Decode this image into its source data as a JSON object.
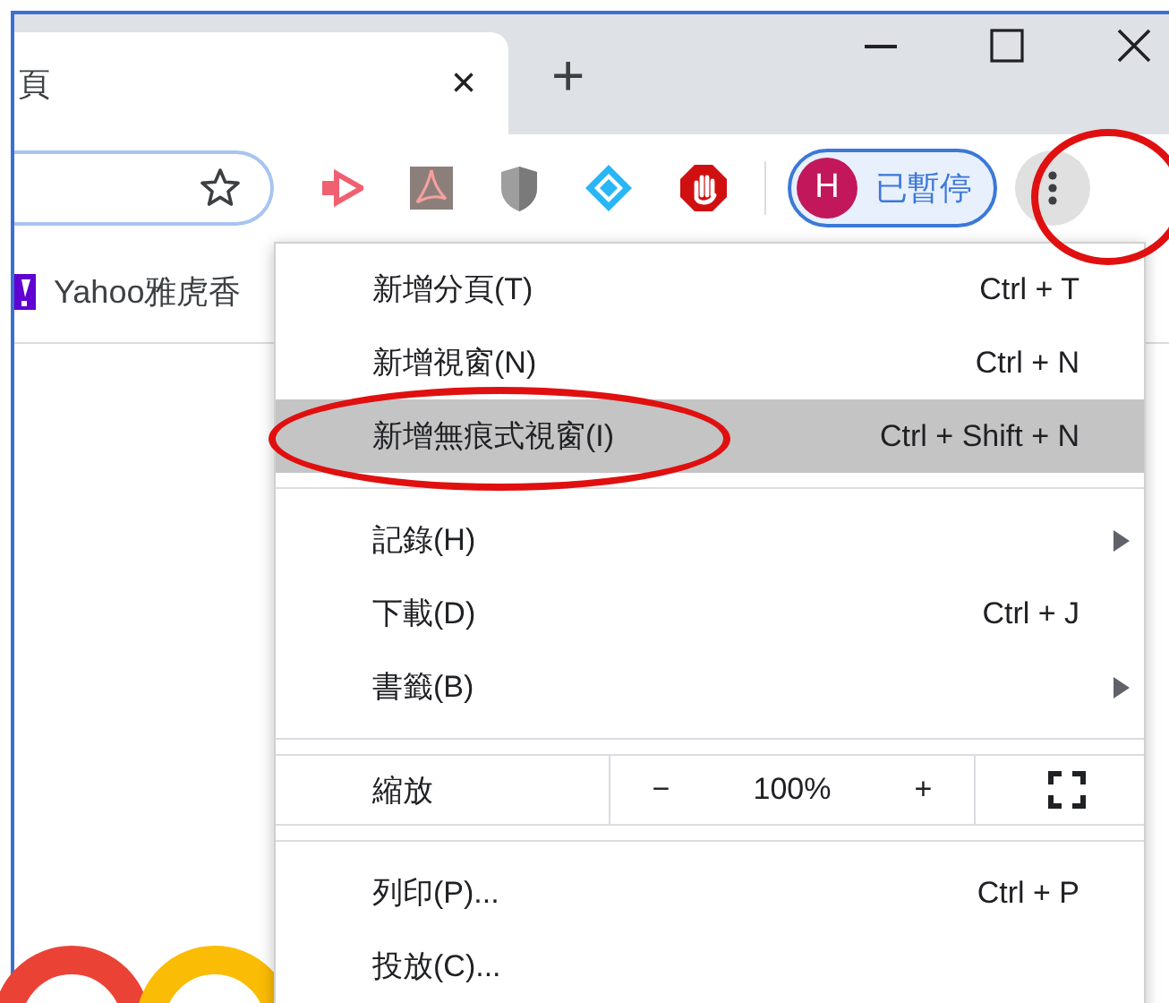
{
  "tab": {
    "title": "頁",
    "close": "×",
    "new_tab": "+"
  },
  "profile": {
    "initial": "H",
    "status": "已暫停"
  },
  "bookmarks": [
    {
      "label": "Yahoo雅虎香"
    }
  ],
  "menu": [
    {
      "kind": "item",
      "label": "新增分頁(T)",
      "shortcut": "Ctrl + T",
      "submenu": false,
      "selected": false
    },
    {
      "kind": "item",
      "label": "新增視窗(N)",
      "shortcut": "Ctrl + N",
      "submenu": false,
      "selected": false
    },
    {
      "kind": "item",
      "label": "新增無痕式視窗(I)",
      "shortcut": "Ctrl + Shift + N",
      "submenu": false,
      "selected": true
    },
    {
      "kind": "separator"
    },
    {
      "kind": "item",
      "label": "記錄(H)",
      "submenu": true,
      "selected": false
    },
    {
      "kind": "item",
      "label": "下載(D)",
      "shortcut": "Ctrl + J",
      "submenu": false,
      "selected": false
    },
    {
      "kind": "item",
      "label": "書籤(B)",
      "submenu": true,
      "selected": false
    },
    {
      "kind": "separator"
    },
    {
      "kind": "zoom",
      "label": "縮放",
      "minus": "−",
      "value": "100%",
      "plus": "+"
    },
    {
      "kind": "separator"
    },
    {
      "kind": "item",
      "label": "列印(P)...",
      "shortcut": "Ctrl + P",
      "submenu": false,
      "selected": false
    },
    {
      "kind": "item",
      "label": "投放(C)...",
      "submenu": false,
      "selected": false
    }
  ]
}
